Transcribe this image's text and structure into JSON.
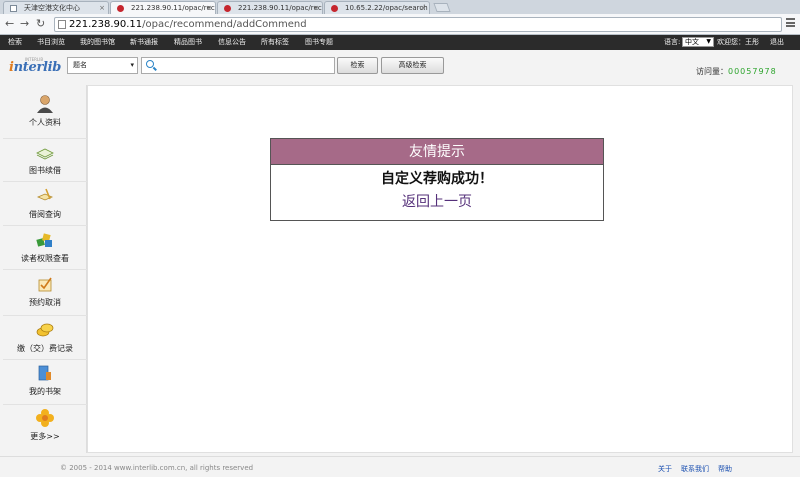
{
  "browser": {
    "tabs": [
      {
        "title": "天津空港文化中心",
        "active": false,
        "favicon": "doc-icon"
      },
      {
        "title": "221.238.90.11/opac/rec",
        "active": true,
        "favicon": "site-icon"
      },
      {
        "title": "221.238.90.11/opac/rec",
        "active": false,
        "favicon": "site-icon"
      },
      {
        "title": "10.65.2.22/opac/search",
        "active": false,
        "favicon": "site-icon"
      }
    ],
    "url_host": "221.238.90.11",
    "url_path": "/opac/recommend/addCommend"
  },
  "site_nav": {
    "items": [
      "检索",
      "书目浏览",
      "我的图书馆",
      "新书通报",
      "精品图书",
      "信息公告",
      "所有标签",
      "图书专题"
    ],
    "language_label": "语言:",
    "language_value": "中文",
    "welcome": "欢迎您：王彤",
    "logout": "退出"
  },
  "search": {
    "logo_text": "interlib",
    "logo_small": "INTERLIB",
    "field_value": "题名",
    "query": "",
    "search_button": "检索",
    "advanced_button": "高级检索",
    "visits_label": "访问量：",
    "visits_count": "00057978"
  },
  "sidebar": {
    "items": [
      {
        "label": "个人资料",
        "icon": "user-icon"
      },
      {
        "label": "图书续借",
        "icon": "book-renew-icon"
      },
      {
        "label": "借阅查询",
        "icon": "borrow-query-icon"
      },
      {
        "label": "读者权限查看",
        "icon": "permission-icon"
      },
      {
        "label": "预约取消",
        "icon": "reservation-cancel-icon"
      },
      {
        "label": "缴（交）费记录",
        "icon": "coins-icon"
      },
      {
        "label": "我的书架",
        "icon": "bookshelf-icon"
      },
      {
        "label": "更多>>",
        "icon": "flower-icon"
      }
    ]
  },
  "dialog": {
    "title": "友情提示",
    "message": "自定义荐购成功！",
    "back_link": "返回上一页"
  },
  "footer": {
    "copyright": "© 2005 - 2014 www.interlib.com.cn, all rights reserved",
    "links": [
      "关于",
      "联系我们",
      "帮助"
    ]
  },
  "colors": {
    "dialog_header": "#a66a88",
    "nav_bar": "#2b2b2b",
    "visits_count": "#2da42d",
    "link": "#55307a"
  }
}
